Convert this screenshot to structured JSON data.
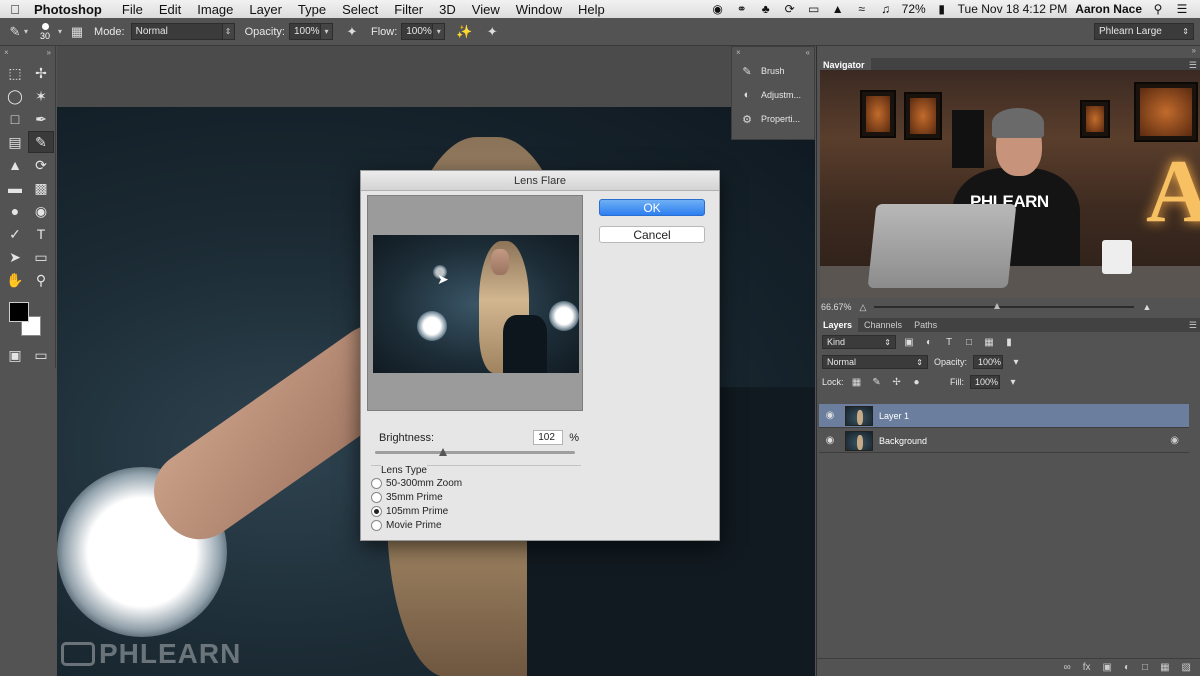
{
  "menubar": {
    "app_name": "Photoshop",
    "menus": [
      "File",
      "Edit",
      "Image",
      "Layer",
      "Type",
      "Select",
      "Filter",
      "3D",
      "View",
      "Window",
      "Help"
    ],
    "battery": "72%",
    "datetime": "Tue Nov 18  4:12 PM",
    "user": "Aaron Nace"
  },
  "options": {
    "brush_size": "30",
    "mode_label": "Mode:",
    "mode_value": "Normal",
    "opacity_label": "Opacity:",
    "opacity_value": "100%",
    "flow_label": "Flow:",
    "flow_value": "100%",
    "workspace": "Phlearn Large"
  },
  "mini_dock": {
    "items": [
      {
        "label": "Brush",
        "icon": "brush-panel-icon"
      },
      {
        "label": "Adjustm...",
        "icon": "adjustments-icon"
      },
      {
        "label": "Properti...",
        "icon": "properties-icon"
      }
    ]
  },
  "dialog": {
    "title": "Lens Flare",
    "ok_label": "OK",
    "cancel_label": "Cancel",
    "brightness_label": "Brightness:",
    "brightness_value": "102",
    "brightness_unit": "%",
    "brightness_slider_fraction": 0.34,
    "lens_type_label": "Lens Type",
    "lens_options": [
      "50-300mm Zoom",
      "35mm Prime",
      "105mm Prime",
      "Movie Prime"
    ],
    "selected_lens": "105mm Prime"
  },
  "navigator": {
    "tab": "Navigator",
    "zoom": "66.67%",
    "thumb_text": "PHLEARN",
    "thumb_letter": "A"
  },
  "layers": {
    "tabs": [
      "Layers",
      "Channels",
      "Paths"
    ],
    "kind_label": "Kind",
    "blend_mode": "Normal",
    "opacity_label": "Opacity:",
    "opacity_value": "100%",
    "lock_label": "Lock:",
    "fill_label": "Fill:",
    "fill_value": "100%",
    "rows": [
      {
        "name": "Layer 1",
        "selected": true
      },
      {
        "name": "Background",
        "selected": false,
        "locked": true
      }
    ]
  },
  "watermark": "PHLEARN",
  "colors": {
    "accent_blue": "#2d7ef0",
    "selected_layer": "#6b7e9e",
    "panel_bg": "#535353"
  }
}
